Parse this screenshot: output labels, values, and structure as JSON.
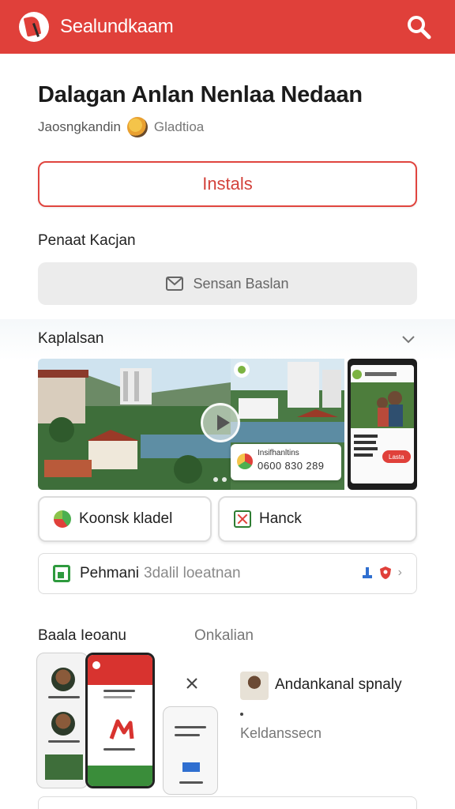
{
  "header": {
    "brand": "Sealundkaam",
    "icons": [
      "app-logo-icon",
      "search-icon"
    ],
    "color": "#e0403a"
  },
  "app": {
    "title": "Dalagan Anlan Nenlaa Nedaan",
    "developer_prefix": "Jaosngkandin",
    "developer": "Gladtioa"
  },
  "install": {
    "label": "Instals"
  },
  "contact": {
    "heading": "Penaat Kacjan",
    "button_label": "Sensan Baslan"
  },
  "gallery": {
    "heading": "Kaplalsan",
    "info_card": {
      "line1": "Insifhanltins",
      "number": "0600 830 289"
    },
    "phone_card_button": "Lasta"
  },
  "chips": [
    {
      "label": "Koonsk kladel",
      "icon": "app-badge-icon"
    },
    {
      "label": "Hanck",
      "icon": "checkbox-x-icon"
    }
  ],
  "permission": {
    "bold": "Pehmani",
    "light": "3dalil loeatnan"
  },
  "reviews": {
    "left_heading": "Baala Ieoanu",
    "right_heading": "Onkalian",
    "reviewer": "Andankanal spnaly",
    "review_text": "Keldanssecn"
  }
}
